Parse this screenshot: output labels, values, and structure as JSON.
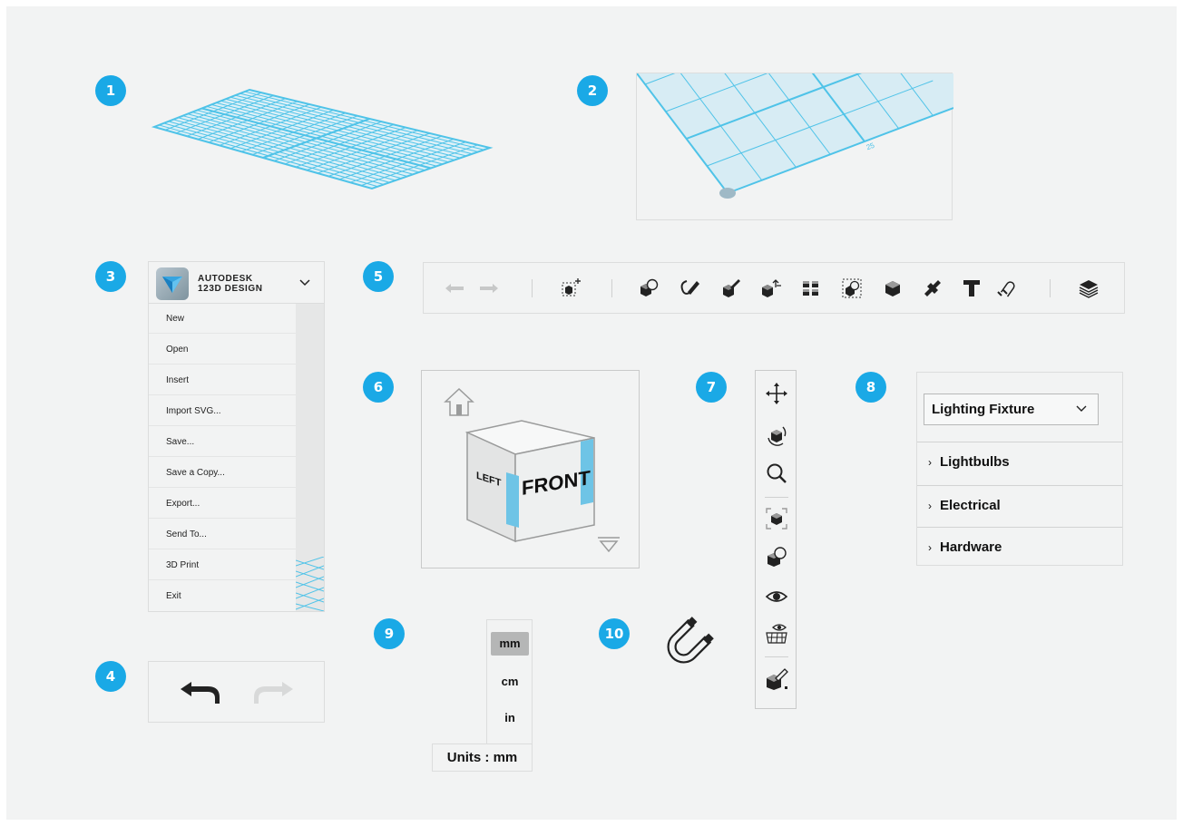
{
  "callouts": [
    "1",
    "2",
    "3",
    "4",
    "5",
    "6",
    "7",
    "8",
    "9",
    "10"
  ],
  "grid_panel": {
    "dimension_label": "25"
  },
  "main_menu": {
    "brand_line1": "AUTODESK",
    "brand_line2": "123D DESIGN",
    "dropdown_icon": "chevron-down-icon",
    "items": [
      "New",
      "Open",
      "Insert",
      "Import SVG...",
      "Save...",
      "Save a Copy...",
      "Export...",
      "Send To...",
      "3D Print",
      "Exit"
    ]
  },
  "undo_redo": {
    "undo_icon": "undo-arrow-icon",
    "redo_icon": "redo-arrow-icon",
    "redo_enabled": false
  },
  "toolbar": {
    "icons": [
      "undo-icon",
      "redo-icon",
      "transform-icon",
      "primitives-icon",
      "sketch-icon",
      "construct-icon",
      "modify-icon",
      "pattern-icon",
      "grouping-icon",
      "combine-icon",
      "measure-icon",
      "text-icon",
      "snap-icon",
      "materials-icon"
    ]
  },
  "view_cube": {
    "left_face": "LEFT",
    "front_face": "FRONT",
    "home_icon": "home-icon",
    "menu_icon": "view-menu-triangle-icon"
  },
  "navigation_bar": {
    "icons": [
      "pan-icon",
      "orbit-icon",
      "zoom-icon",
      "fit-icon",
      "materials-view-icon",
      "visibility-icon",
      "grid-visibility-icon",
      "solid-edit-icon"
    ]
  },
  "parts_panel": {
    "selected": "Lighting Fixture",
    "categories": [
      "Lightbulbs",
      "Electrical",
      "Hardware"
    ],
    "accent": "#1aa9e6"
  },
  "units": {
    "options": [
      "mm",
      "cm",
      "in"
    ],
    "selected_index": 0,
    "label": "Units : mm"
  },
  "snap": {
    "icon": "magnet-icon"
  },
  "colors": {
    "accent": "#1aa9e6",
    "grid_line": "#4fc3e8",
    "grid_fill": "#d6edf5"
  }
}
